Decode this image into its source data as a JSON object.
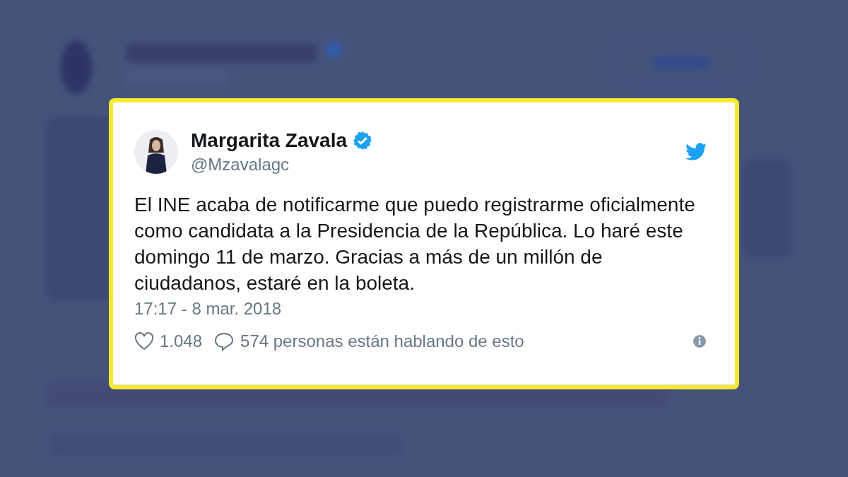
{
  "tweet": {
    "author": {
      "name": "Margarita Zavala",
      "verified": true,
      "handle": "@Mzavalagc"
    },
    "text": "El INE acaba de notificarme que puedo registrarme oficialmente como candidata a la Presidencia de la República. Lo haré este domingo 11 de marzo. Gracias a más de un millón de ciudadanos, estaré en la boleta.",
    "timestamp": "17:17 - 8 mar. 2018",
    "likes": "1.048",
    "conversation": "574 personas están hablando de esto"
  }
}
